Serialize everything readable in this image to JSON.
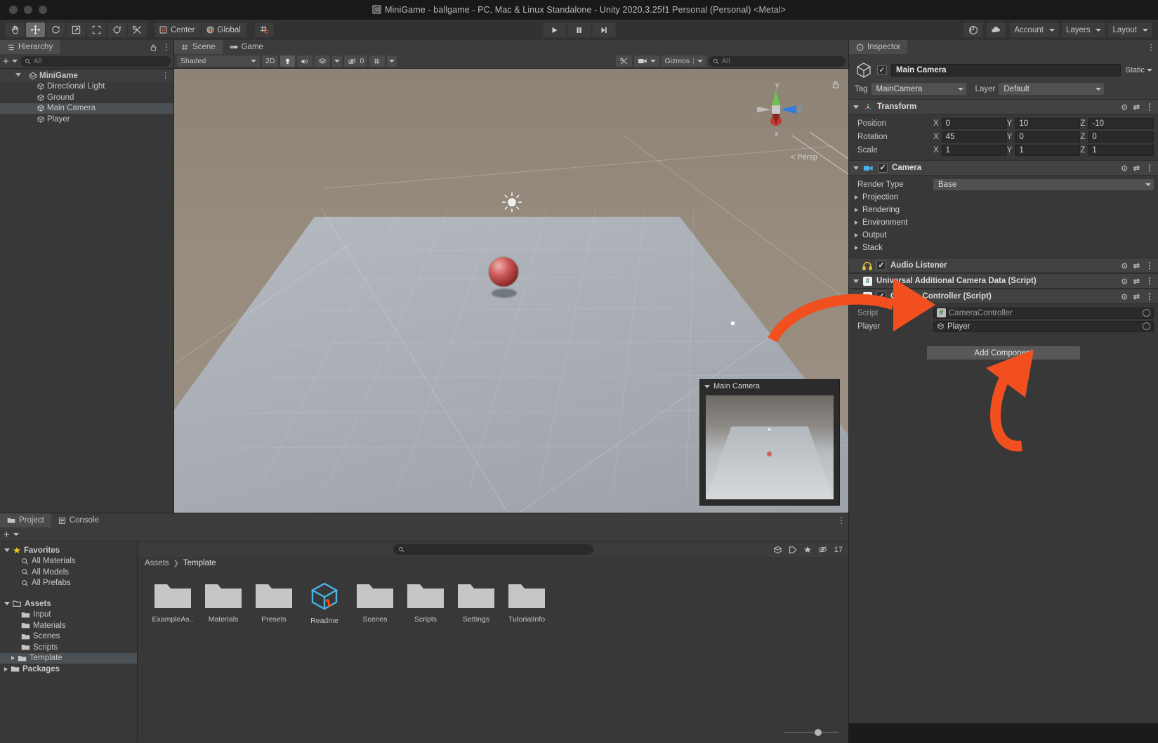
{
  "window": {
    "title": "MiniGame - ballgame - PC, Mac & Linux Standalone - Unity 2020.3.25f1 Personal (Personal) <Metal>",
    "app_icon": "unity-icon"
  },
  "toolbar": {
    "tools": [
      {
        "name": "hand-tool",
        "icon": "hand-icon",
        "active": false
      },
      {
        "name": "move-tool",
        "icon": "move-icon",
        "active": true
      },
      {
        "name": "rotate-tool",
        "icon": "rotate-icon",
        "active": false
      },
      {
        "name": "scale-tool",
        "icon": "scale-icon",
        "active": false
      },
      {
        "name": "rect-tool",
        "icon": "rect-transform-icon",
        "active": false
      },
      {
        "name": "transform-tool",
        "icon": "transform-icon",
        "active": false
      },
      {
        "name": "custom-tool",
        "icon": "wrench-icon",
        "active": false
      }
    ],
    "pivot_mode": "Center",
    "pivot_rotation": "Global",
    "snap_label": "grid-snap-icon",
    "play": "play-icon",
    "pause": "pause-icon",
    "step": "step-icon",
    "cloud_icon": "cloud-icon",
    "collab_icon": "collab-icon",
    "account": "Account",
    "layers": "Layers",
    "layout": "Layout"
  },
  "hierarchy": {
    "tab": "Hierarchy",
    "tab_icon": "hierarchy-icon",
    "lock_icon": "lock-icon",
    "menu_icon": "kebab-icon",
    "add_label": "+",
    "search_placeholder": "All",
    "items": [
      {
        "label": "MiniGame",
        "depth": 0,
        "icon": "scene-icon",
        "selected": false,
        "expanded": true,
        "root": true
      },
      {
        "label": "Directional Light",
        "depth": 1,
        "icon": "gameobject-icon",
        "selected": false
      },
      {
        "label": "Ground",
        "depth": 1,
        "icon": "gameobject-icon",
        "selected": false
      },
      {
        "label": "Main Camera",
        "depth": 1,
        "icon": "gameobject-icon",
        "selected": true
      },
      {
        "label": "Player",
        "depth": 1,
        "icon": "gameobject-icon",
        "selected": false
      }
    ]
  },
  "scene": {
    "tabs": [
      {
        "label": "Scene",
        "icon": "scene-grid-icon",
        "active": true
      },
      {
        "label": "Game",
        "icon": "gamepad-icon",
        "active": false
      }
    ],
    "draw_mode": "Shaded",
    "two_d": "2D",
    "lighting_icon": "light-bulb-icon",
    "audio_icon": "speaker-icon",
    "fx_icon": "fx-icon",
    "hidden_count": "0",
    "grid_icon": "grid-icon",
    "tools_icon": "tools-icon",
    "camera_icon": "camera-icon",
    "gizmos": "Gizmos",
    "search_placeholder": "All",
    "axis_labels": {
      "x": "x",
      "y": "y",
      "z": "z"
    },
    "persp_label": "Persp",
    "camera_preview_title": "Main Camera"
  },
  "inspector": {
    "tab": "Inspector",
    "tab_icon": "info-icon",
    "object_name": "Main Camera",
    "enabled": true,
    "static_label": "Static",
    "tag_label": "Tag",
    "tag_value": "MainCamera",
    "layer_label": "Layer",
    "layer_value": "Default",
    "components": [
      {
        "name": "Transform",
        "icon": "transform-gizmo-icon",
        "expanded": true,
        "has_checkbox": false,
        "rows": [
          {
            "label": "Position",
            "x": "0",
            "y": "10",
            "z": "-10"
          },
          {
            "label": "Rotation",
            "x": "45",
            "y": "0",
            "z": "0"
          },
          {
            "label": "Scale",
            "x": "1",
            "y": "1",
            "z": "1"
          }
        ]
      },
      {
        "name": "Camera",
        "icon": "camera-component-icon",
        "expanded": true,
        "has_checkbox": true,
        "checked": true,
        "render_type_label": "Render Type",
        "render_type_value": "Base",
        "foldouts": [
          "Projection",
          "Rendering",
          "Environment",
          "Output",
          "Stack"
        ]
      },
      {
        "name": "Audio Listener",
        "icon": "headphones-icon",
        "expanded": false,
        "has_checkbox": true,
        "checked": true
      },
      {
        "name": "Universal Additional Camera Data (Script)",
        "icon": "script-icon",
        "expanded": true,
        "has_checkbox": false
      },
      {
        "name": "Camera Controller (Script)",
        "icon": "script-icon",
        "expanded": true,
        "has_checkbox": true,
        "checked": true,
        "script_label": "Script",
        "script_value": "CameraController",
        "player_label": "Player",
        "player_value": "Player"
      }
    ],
    "add_component": "Add Component",
    "help_icon": "help-icon",
    "preset_icon": "preset-icon",
    "kebab_icon": "kebab-icon"
  },
  "project": {
    "tabs": [
      {
        "label": "Project",
        "icon": "folder-icon",
        "active": true
      },
      {
        "label": "Console",
        "icon": "console-icon",
        "active": false
      }
    ],
    "add_label": "+",
    "search_placeholder": "",
    "search_icon": "search-icon",
    "filter_icons": [
      "package-filter-icon",
      "label-filter-icon",
      "favorite-filter-icon"
    ],
    "hidden_count": "17",
    "tree": [
      {
        "label": "Favorites",
        "depth": 0,
        "icon": "star-icon",
        "expanded": true,
        "bold": true
      },
      {
        "label": "All Materials",
        "depth": 1,
        "icon": "search-icon"
      },
      {
        "label": "All Models",
        "depth": 1,
        "icon": "search-icon"
      },
      {
        "label": "All Prefabs",
        "depth": 1,
        "icon": "search-icon"
      },
      {
        "label": "",
        "depth": 0,
        "icon": "spacer"
      },
      {
        "label": "Assets",
        "depth": 0,
        "icon": "folder-open-icon",
        "expanded": true,
        "bold": true
      },
      {
        "label": "Input",
        "depth": 1,
        "icon": "folder-icon"
      },
      {
        "label": "Materials",
        "depth": 1,
        "icon": "folder-icon"
      },
      {
        "label": "Scenes",
        "depth": 1,
        "icon": "folder-icon"
      },
      {
        "label": "Scripts",
        "depth": 1,
        "icon": "folder-icon"
      },
      {
        "label": "Template",
        "depth": 1,
        "icon": "folder-icon",
        "selected": true,
        "collapsed": true
      },
      {
        "label": "Packages",
        "depth": 0,
        "icon": "folder-icon",
        "collapsed": true,
        "bold": true
      }
    ],
    "breadcrumb": [
      "Assets",
      "Template"
    ],
    "assets": [
      {
        "label": "ExampleAs..",
        "icon": "folder-icon"
      },
      {
        "label": "Materials",
        "icon": "folder-icon"
      },
      {
        "label": "Presets",
        "icon": "folder-icon"
      },
      {
        "label": "Readme",
        "icon": "readme-asset-icon"
      },
      {
        "label": "Scenes",
        "icon": "folder-icon"
      },
      {
        "label": "Scripts",
        "icon": "folder-icon"
      },
      {
        "label": "Settings",
        "icon": "folder-icon"
      },
      {
        "label": "TutorialInfo",
        "icon": "folder-icon"
      }
    ]
  },
  "annotations": {
    "arrow_color": "#f1501e",
    "arrows": [
      {
        "name": "arrow-to-camera-controller",
        "target": "Camera Controller (Script) header"
      },
      {
        "name": "arrow-to-player-field",
        "target": "Player object field"
      }
    ]
  },
  "colors": {
    "accent_orange": "#f1501e",
    "panel_bg": "#383838",
    "header_bg": "#3c3c3c",
    "selection": "#4b5054",
    "text": "#c4c4c4"
  }
}
